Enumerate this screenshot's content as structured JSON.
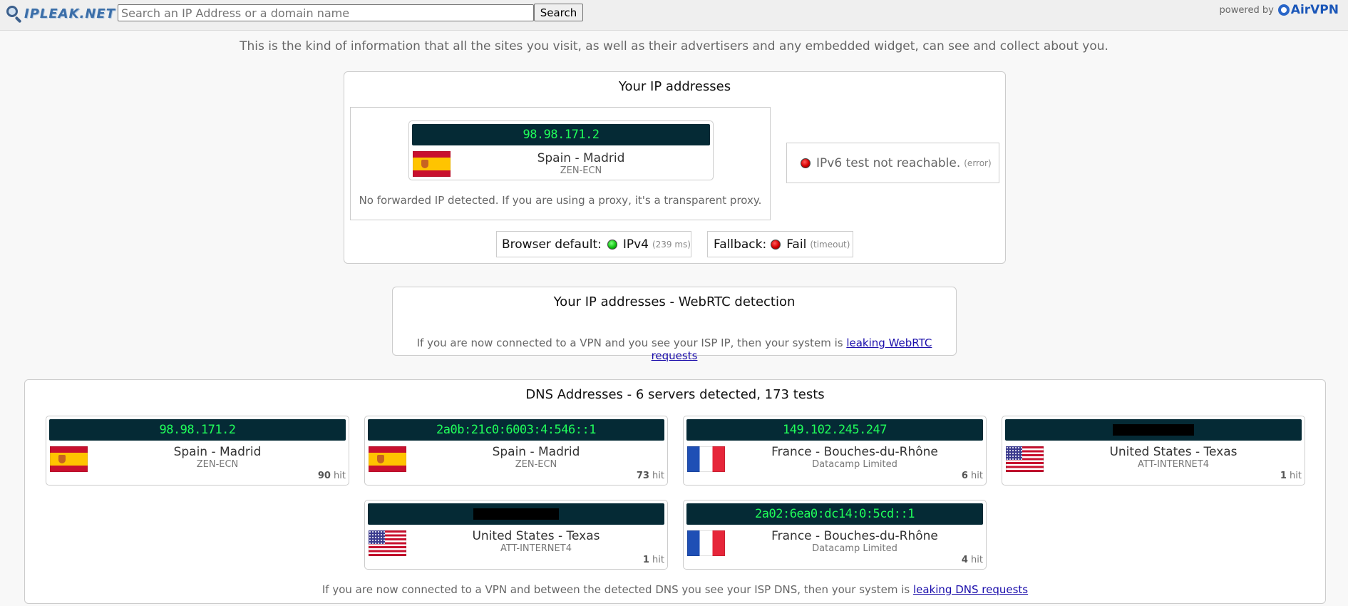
{
  "header": {
    "logo_text": "IPLEAK.NET",
    "search_placeholder": "Search an IP Address or a domain name",
    "search_button": "Search",
    "powered_by": "powered by",
    "brand": "AirVPN"
  },
  "intro": "This is the kind of information that all the sites you visit, as well as their advertisers and any embedded widget, can see and collect about you.",
  "ip_section": {
    "title": "Your IP addresses",
    "ipv4": {
      "ip": "98.98.171.2",
      "location": "Spain - Madrid",
      "isp": "ZEN-ECN",
      "flag": "spain-flag-icon"
    },
    "forwarded_note": "No forwarded IP detected. If you are using a proxy, it's a transparent proxy.",
    "ipv6": {
      "text": "IPv6 test not reachable.",
      "note": "(error)"
    },
    "browser_default": {
      "label": "Browser default:",
      "value": "IPv4",
      "note": "(239 ms)"
    },
    "fallback": {
      "label": "Fallback:",
      "value": "Fail",
      "note": "(timeout)"
    }
  },
  "webrtc": {
    "title": "Your IP addresses - WebRTC detection",
    "text": "If you are now connected to a VPN and you see your ISP IP, then your system is",
    "link": "leaking WebRTC requests"
  },
  "dns": {
    "title": "DNS Addresses - 6 servers detected, 173 tests",
    "hit_label": "hit",
    "servers": [
      {
        "ip": "98.98.171.2",
        "location": "Spain - Madrid",
        "isp": "ZEN-ECN",
        "hits": "90",
        "flag": "spain-flag-icon"
      },
      {
        "ip": "2a0b:21c0:6003:4:546::1",
        "location": "Spain - Madrid",
        "isp": "ZEN-ECN",
        "hits": "73",
        "flag": "spain-flag-icon"
      },
      {
        "ip": "149.102.245.247",
        "location": "France - Bouches-du-Rhône",
        "isp": "Datacamp Limited",
        "hits": "6",
        "flag": "france-flag-icon"
      },
      {
        "ip": "",
        "location": "United States - Texas",
        "isp": "ATT-INTERNET4",
        "hits": "1",
        "flag": "usa-flag-icon"
      },
      {
        "ip": "",
        "location": "United States - Texas",
        "isp": "ATT-INTERNET4",
        "hits": "1",
        "flag": "usa-flag-icon"
      },
      {
        "ip": "2a02:6ea0:dc14:0:5cd::1",
        "location": "France - Bouches-du-Rhône",
        "isp": "Datacamp Limited",
        "hits": "4",
        "flag": "france-flag-icon"
      }
    ],
    "footer_text": "If you are now connected to a VPN and between the detected DNS you see your ISP DNS, then your system is",
    "footer_link": "leaking DNS requests"
  },
  "colors": {
    "ip_bar_bg": "#052a35",
    "ip_bar_text": "#20ff5a",
    "link": "#1a0dab",
    "status_red": "#d40000",
    "status_green": "#12c412"
  }
}
